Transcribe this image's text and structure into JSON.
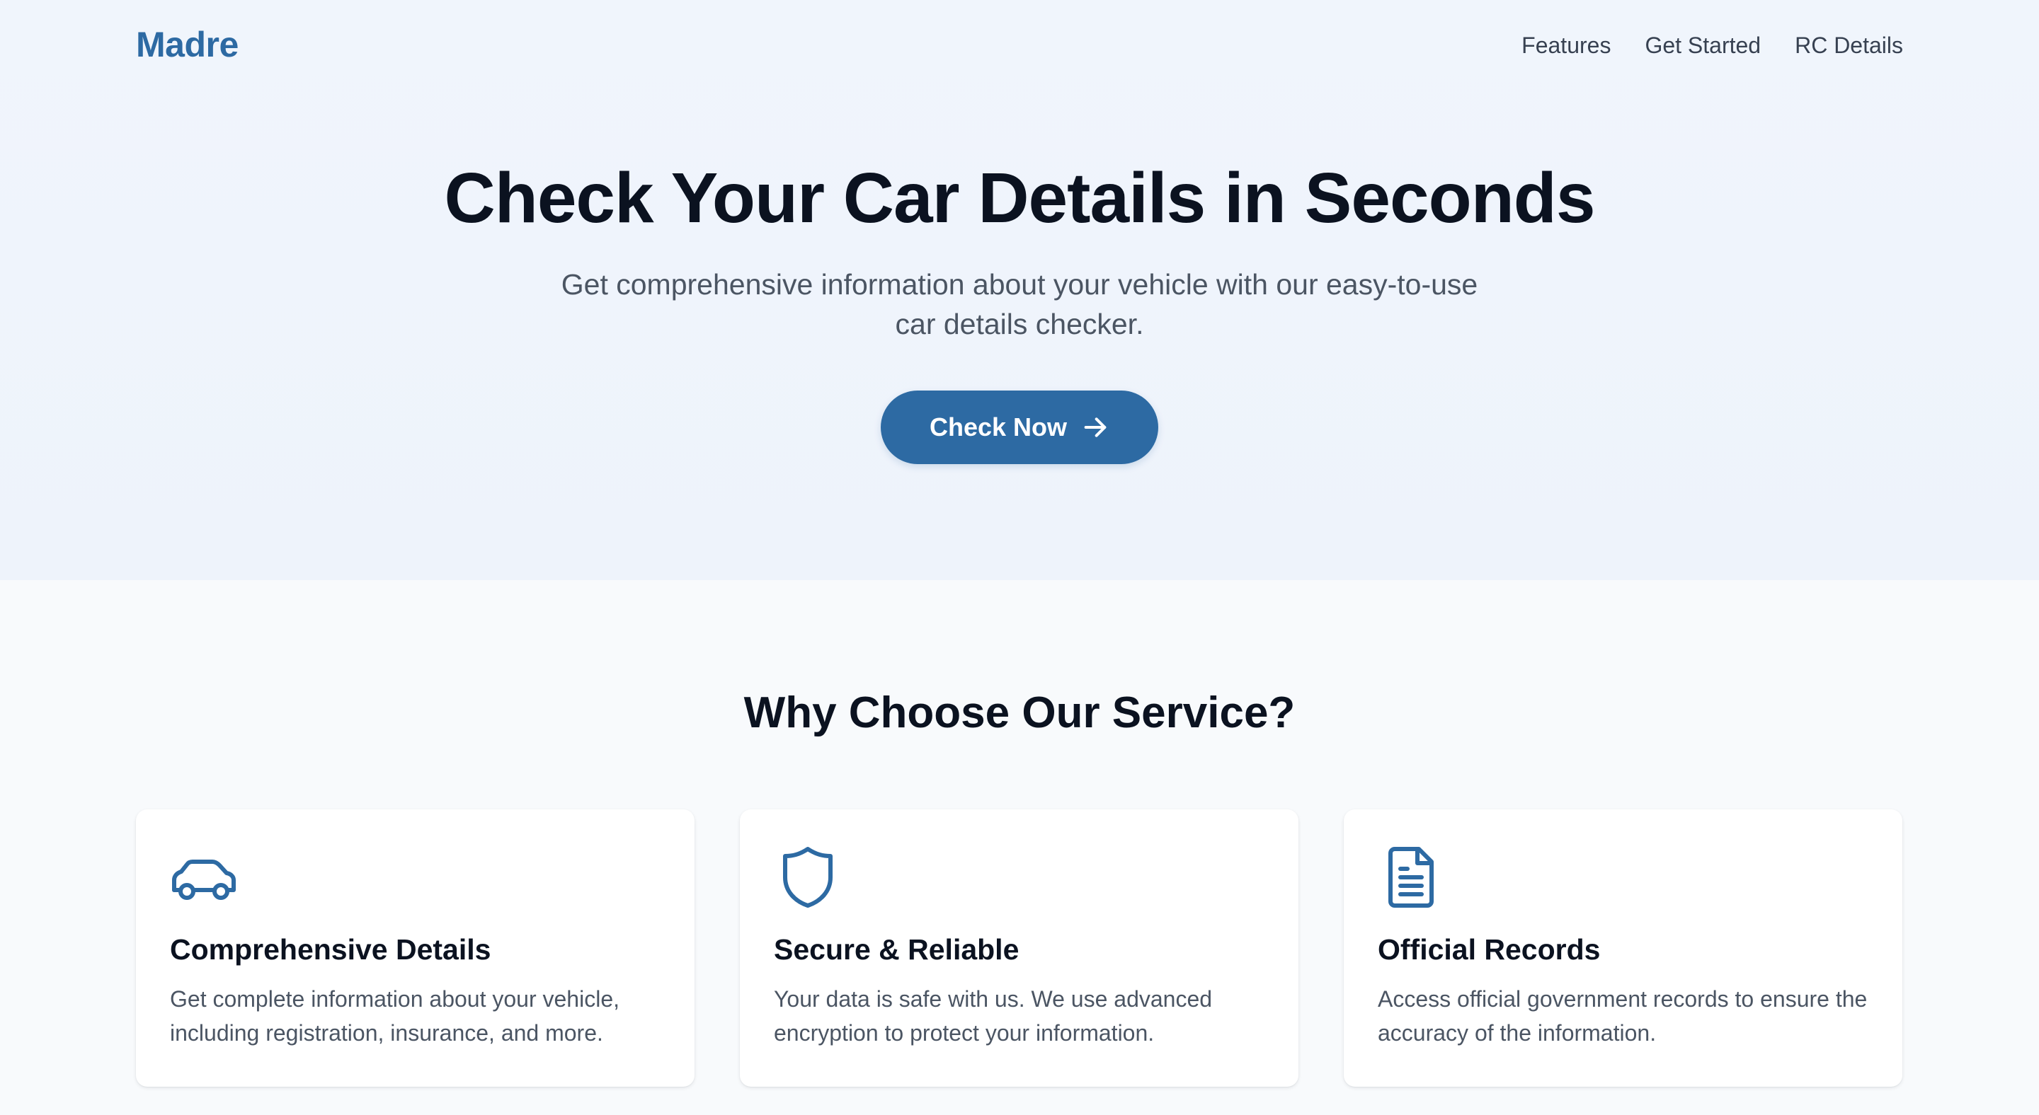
{
  "brand": {
    "name": "Madre",
    "color": "#2d6aa3"
  },
  "nav": {
    "links": [
      {
        "label": "Features"
      },
      {
        "label": "Get Started"
      },
      {
        "label": "RC Details"
      }
    ]
  },
  "hero": {
    "title": "Check Your Car Details in Seconds",
    "subtitle": "Get comprehensive information about your vehicle with our easy-to-use car details checker.",
    "cta_label": "Check Now",
    "cta_icon": "arrow-right-icon"
  },
  "features": {
    "title": "Why Choose Our Service?",
    "cards": [
      {
        "icon": "car-icon",
        "title": "Comprehensive Details",
        "text": "Get complete information about your vehicle, including registration, insurance, and more."
      },
      {
        "icon": "shield-icon",
        "title": "Secure & Reliable",
        "text": "Your data is safe with us. We use advanced encryption to protect your information."
      },
      {
        "icon": "document-icon",
        "title": "Official Records",
        "text": "Access official government records to ensure the accuracy of the information."
      }
    ]
  },
  "colors": {
    "accent": "#2d6aa3",
    "hero_background": "#eff4fb",
    "page_background": "#f8fafc",
    "heading_text": "#0b1220",
    "body_text": "#4b5563"
  }
}
